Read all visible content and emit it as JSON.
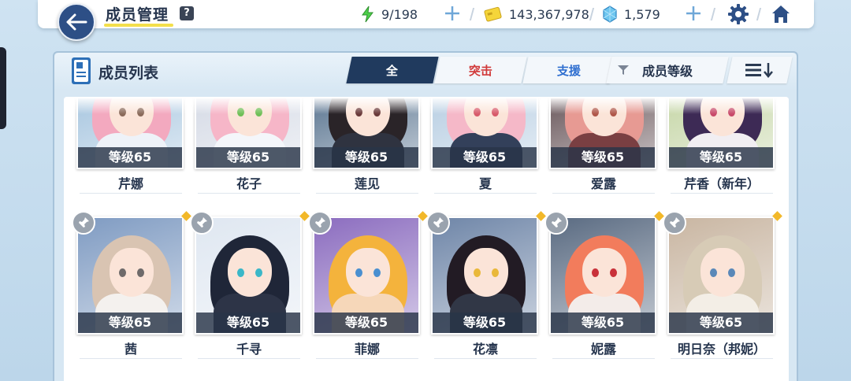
{
  "header": {
    "title": "成员管理",
    "help_label": "?",
    "ap": "9/198",
    "credits": "143,367,978",
    "pyroxene": "1,579"
  },
  "panel": {
    "title": "成员列表",
    "tabs": [
      {
        "label": "全",
        "active": true
      },
      {
        "label": "突击",
        "active": false
      },
      {
        "label": "支援",
        "active": false
      }
    ],
    "sort_label": "成员等级"
  },
  "characters_row1": [
    {
      "name": "芹娜",
      "level": "等级65",
      "hair": "#f3a9bf",
      "eye": "#8a6a5a",
      "body": "#eef2f8",
      "bg": "#a9c7e0"
    },
    {
      "name": "花子",
      "level": "等级65",
      "hair": "#f6b6c8",
      "eye": "#6fbf57",
      "body": "#f4f6fa",
      "bg": "#d6dbe6"
    },
    {
      "name": "莲见",
      "level": "等级65",
      "hair": "#2a2428",
      "eye": "#6a3a3a",
      "body": "#2f3340",
      "bg": "#5e7893"
    },
    {
      "name": "夏",
      "level": "等级65",
      "hair": "#f5b8c8",
      "eye": "#d85a6a",
      "body": "#33405a",
      "bg": "#b9cfe3"
    },
    {
      "name": "爱露",
      "level": "等级65",
      "hair": "#e79a93",
      "eye": "#b0574a",
      "body": "#7a3f42",
      "bg": "#6c5a5e"
    },
    {
      "name": "芹香（新年）",
      "level": "等级65",
      "hair": "#3d2a55",
      "eye": "#c84a6a",
      "body": "#f1eef2",
      "bg": "#c7d7a9"
    }
  ],
  "characters_row2": [
    {
      "name": "茜",
      "level": "等级65",
      "hair": "#d9c4b2",
      "eye": "#6e6a6a",
      "body": "#f4f1ee",
      "bg": "#7f9bc2"
    },
    {
      "name": "千寻",
      "level": "等级65",
      "hair": "#1f2638",
      "eye": "#3bb7c8",
      "body": "#2d3447",
      "bg": "#dfe7f1"
    },
    {
      "name": "菲娜",
      "level": "等级65",
      "hair": "#f4b33c",
      "eye": "#4a8fd0",
      "body": "#f6d7b9",
      "bg": "#8b6cbf"
    },
    {
      "name": "花凛",
      "level": "等级65",
      "hair": "#221b24",
      "eye": "#e9b83a",
      "body": "#313746",
      "bg": "#6f86a8"
    },
    {
      "name": "妮露",
      "level": "等级65",
      "hair": "#f27c5c",
      "eye": "#c9313a",
      "body": "#f3ece9",
      "bg": "#5a6b82"
    },
    {
      "name": "明日奈（邦妮）",
      "level": "等级65",
      "hair": "#d7cbb6",
      "eye": "#5a88b8",
      "body": "#f3eee6",
      "bg": "#c9b6a2"
    }
  ]
}
